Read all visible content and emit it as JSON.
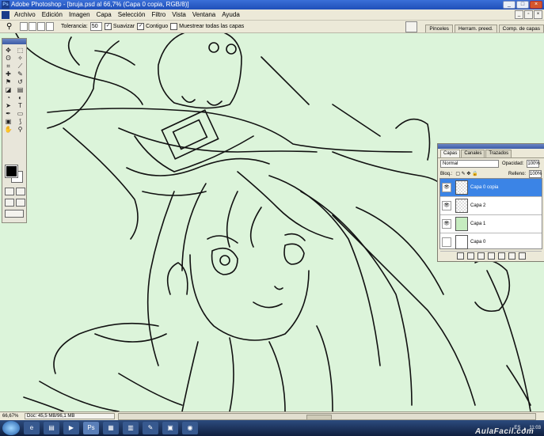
{
  "window": {
    "title": "Adobe Photoshop - [bruja.psd al 66,7% (Capa 0 copia, RGB/8)]",
    "logo_text": "Ps"
  },
  "menu": [
    "Archivo",
    "Edición",
    "Imagen",
    "Capa",
    "Selección",
    "Filtro",
    "Vista",
    "Ventana",
    "Ayuda"
  ],
  "options": {
    "tolerance_label": "Tolerancia:",
    "tolerance_value": "50",
    "smooth_label": "Suavizar",
    "contiguous_label": "Contiguo",
    "sample_all_label": "Muestrear todas las capas",
    "panel_tabs": [
      "Pinceles",
      "Herram. preed.",
      "Comp. de capas"
    ]
  },
  "layers_panel": {
    "tabs": [
      "Capas",
      "Canales",
      "Trazados"
    ],
    "blend_mode": "Normal",
    "opacity_label": "Opacidad:",
    "opacity_value": "100%",
    "lock_label": "Bloq.:",
    "fill_label": "Relleno:",
    "fill_value": "100%",
    "layers": [
      {
        "name": "Capa 0 copia",
        "visible": true,
        "active": true
      },
      {
        "name": "Capa 2",
        "visible": true,
        "active": false
      },
      {
        "name": "Capa 1",
        "visible": true,
        "active": false
      },
      {
        "name": "Capa 0",
        "visible": false,
        "active": false
      }
    ]
  },
  "status": {
    "zoom": "66,67%",
    "doc": "Doc: 45,5 MB/96,1 MB"
  },
  "taskbar": {
    "lang": "ES",
    "time": "11:03"
  },
  "watermark": "AulaFacil.com"
}
